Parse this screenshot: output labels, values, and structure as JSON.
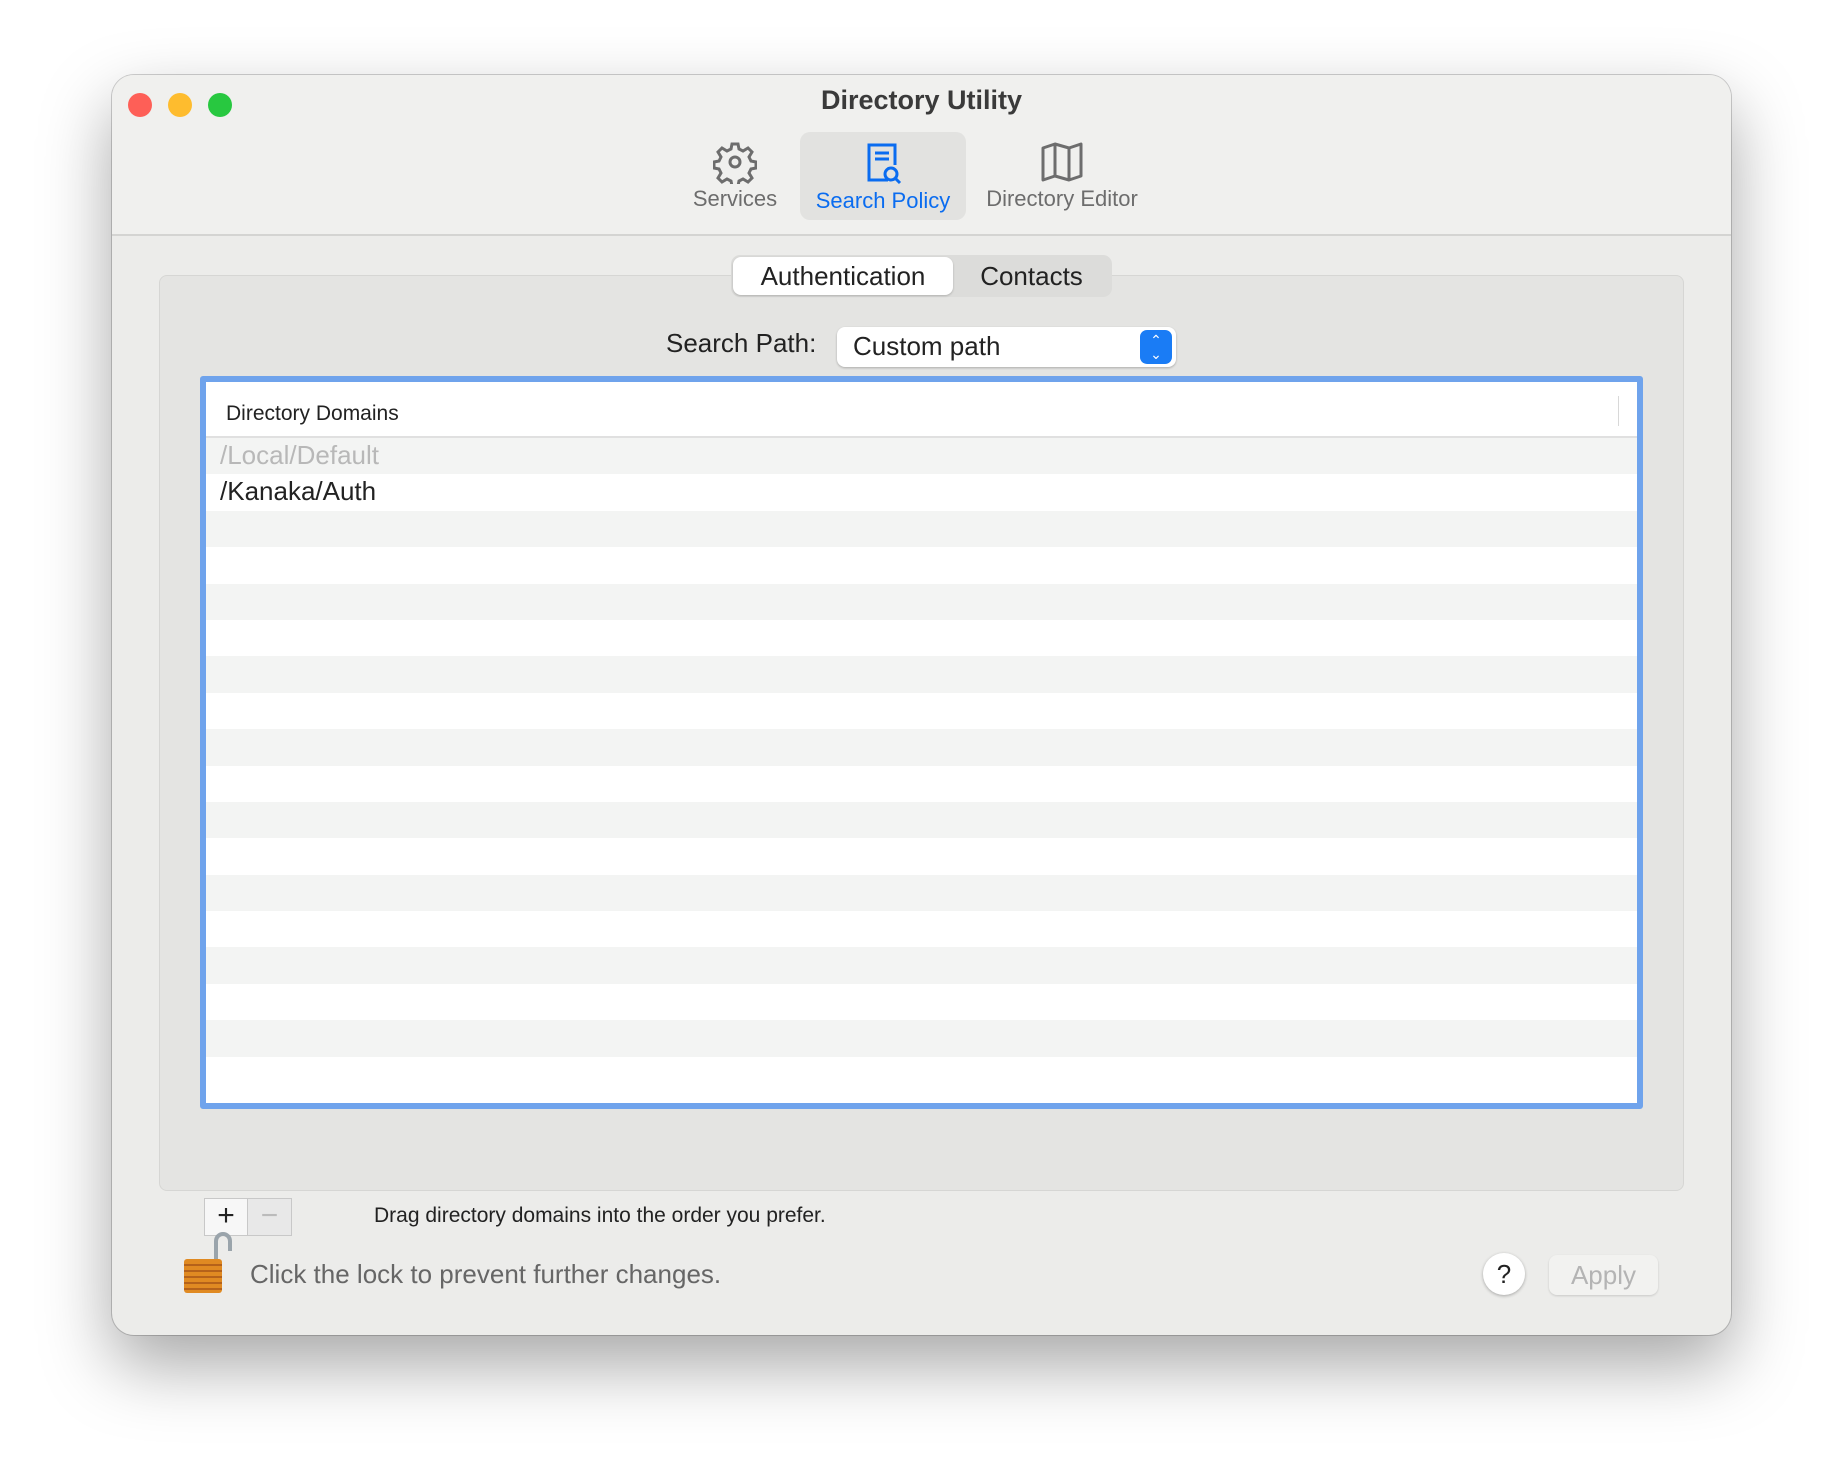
{
  "window": {
    "title": "Directory Utility"
  },
  "toolbar": {
    "items": [
      {
        "label": "Services",
        "icon": "gear-icon"
      },
      {
        "label": "Search Policy",
        "icon": "document-search-icon",
        "selected": true
      },
      {
        "label": "Directory Editor",
        "icon": "map-icon"
      }
    ]
  },
  "tabs": [
    {
      "label": "Authentication",
      "selected": true
    },
    {
      "label": "Contacts"
    }
  ],
  "search_path": {
    "label": "Search Path:",
    "value": "Custom path"
  },
  "table": {
    "header": "Directory Domains",
    "rows": [
      {
        "text": "/Local/Default",
        "disabled": true
      },
      {
        "text": "/Kanaka/Auth"
      }
    ]
  },
  "controls": {
    "add": "+",
    "remove": "−",
    "hint": "Drag directory domains into the order you prefer."
  },
  "footer": {
    "lock_text": "Click the lock to prevent further changes.",
    "help": "?",
    "apply": "Apply"
  },
  "colors": {
    "accent": "#0a6cf0",
    "focus_ring": "#6fa3ec"
  }
}
